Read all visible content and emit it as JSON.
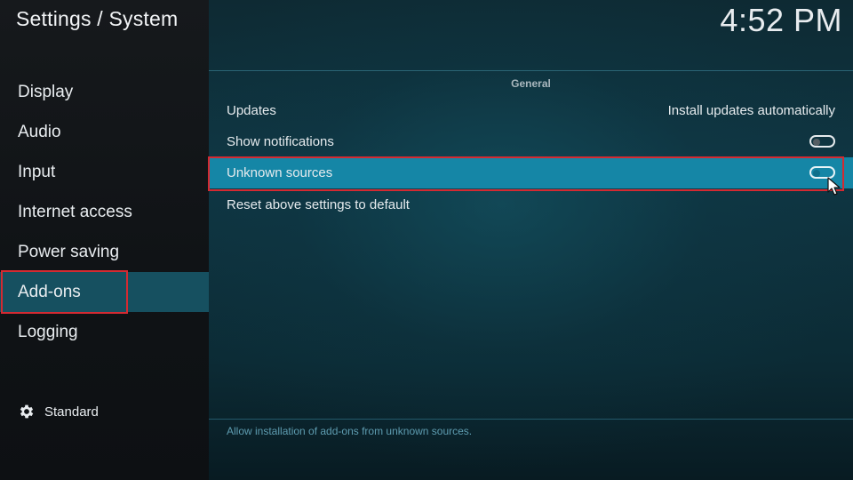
{
  "header": {
    "title": "Settings / System",
    "clock": "4:52 PM"
  },
  "sidebar": {
    "items": [
      {
        "label": "Display"
      },
      {
        "label": "Audio"
      },
      {
        "label": "Input"
      },
      {
        "label": "Internet access"
      },
      {
        "label": "Power saving"
      },
      {
        "label": "Add-ons",
        "active": true
      },
      {
        "label": "Logging"
      }
    ],
    "level": {
      "icon": "gear-icon",
      "label": "Standard"
    }
  },
  "main": {
    "section_title": "General",
    "settings": [
      {
        "label": "Updates",
        "value": "Install updates automatically"
      },
      {
        "label": "Show notifications",
        "toggle": false
      },
      {
        "label": "Unknown sources",
        "toggle": false,
        "focused": true
      },
      {
        "label": "Reset above settings to default"
      }
    ],
    "description": "Allow installation of add-ons from unknown sources."
  },
  "colors": {
    "focus_row": "#1586a6",
    "active_nav": "#165060",
    "highlight_box": "#d42a32"
  }
}
